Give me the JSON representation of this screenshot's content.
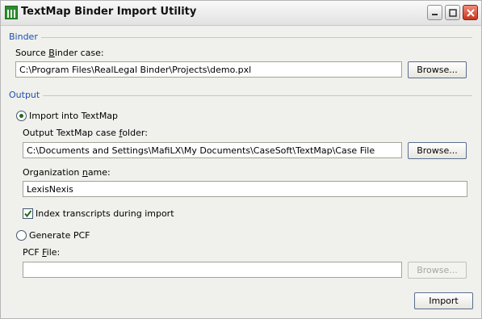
{
  "window": {
    "title": "TextMap Binder Import Utility"
  },
  "binder": {
    "section_label": "Binder",
    "source_label_pre": "Source ",
    "source_label_key": "B",
    "source_label_post": "inder case:",
    "source_value": "C:\\Program Files\\RealLegal Binder\\Projects\\demo.pxl",
    "browse_label": "Browse..."
  },
  "output": {
    "section_label": "Output",
    "import_option": {
      "label": "Import into TextMap",
      "selected": true,
      "folder_label_pre": "Output TextMap case ",
      "folder_label_key": "f",
      "folder_label_post": "older:",
      "folder_value": "C:\\Documents and Settings\\MafiLX\\My Documents\\CaseSoft\\TextMap\\Case File",
      "browse_label": "Browse...",
      "org_label_pre": "Organization ",
      "org_label_key": "n",
      "org_label_post": "ame:",
      "org_value": "LexisNexis",
      "index_checkbox_label": "Index transcripts during import",
      "index_checked": true
    },
    "pcf_option": {
      "label": "Generate PCF",
      "selected": false,
      "file_label_pre": "PCF ",
      "file_label_key": "F",
      "file_label_post": "ile:",
      "file_value": "",
      "browse_label": "Browse..."
    }
  },
  "import_button_label": "Import",
  "colors": {
    "section_blue": "#1c4fb3",
    "check_green": "#1f6b1f",
    "close_red": "#c8361f"
  }
}
